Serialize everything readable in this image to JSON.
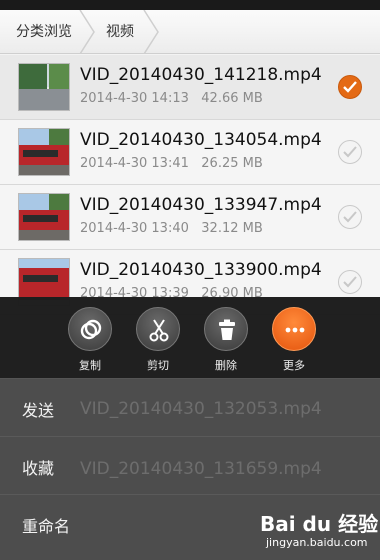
{
  "breadcrumb": {
    "items": [
      "分类浏览",
      "视频"
    ]
  },
  "files": [
    {
      "name": "VID_20140430_141218.mp4",
      "date": "2014-4-30 14:13",
      "size": "42.66 MB",
      "selected": true,
      "thumb": "street"
    },
    {
      "name": "VID_20140430_134054.mp4",
      "date": "2014-4-30 13:41",
      "size": "26.25 MB",
      "selected": false,
      "thumb": "bus"
    },
    {
      "name": "VID_20140430_133947.mp4",
      "date": "2014-4-30 13:40",
      "size": "32.12 MB",
      "selected": false,
      "thumb": "bus"
    },
    {
      "name": "VID_20140430_133900.mp4",
      "date": "2014-4-30 13:39",
      "size": "26.90 MB",
      "selected": false,
      "thumb": "bus"
    }
  ],
  "ghost_files": [
    "VID_20140430_132053.mp4",
    "VID_20140430_131659.mp4"
  ],
  "actions": [
    {
      "label": "复制",
      "icon": "copy-icon"
    },
    {
      "label": "剪切",
      "icon": "scissors-icon"
    },
    {
      "label": "删除",
      "icon": "trash-icon"
    },
    {
      "label": "更多",
      "icon": "more-icon"
    }
  ],
  "menu": [
    "发送",
    "收藏",
    "重命名"
  ],
  "watermark": {
    "brand": "Bai du 经验",
    "url": "jingyan.baidu.com"
  },
  "colors": {
    "accent": "#e46a15",
    "overlay": "#2c2c2c"
  }
}
